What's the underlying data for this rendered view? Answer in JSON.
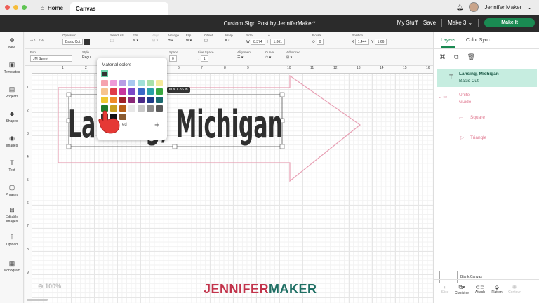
{
  "titlebar": {
    "home_label": "Home",
    "canvas_tab": "Canvas",
    "user_name": "Jennifer Maker",
    "dot_colors": [
      "#ee5f57",
      "#f6bd3a",
      "#5fc453"
    ]
  },
  "header": {
    "doc_title": "Custom Sign Post by JenniferMaker*",
    "my_stuff": "My Stuff",
    "save": "Save",
    "machine": "Make 3",
    "make_it": "Make It"
  },
  "rail": {
    "items": [
      {
        "label": "New",
        "icon": "plus-icon"
      },
      {
        "label": "Templates",
        "icon": "shirt-icon"
      },
      {
        "label": "Projects",
        "icon": "book-icon"
      },
      {
        "label": "Shapes",
        "icon": "shapes-icon"
      },
      {
        "label": "Images",
        "icon": "lightbulb-icon"
      },
      {
        "label": "Text",
        "icon": "text-icon"
      },
      {
        "label": "Phrases",
        "icon": "chat-icon"
      },
      {
        "label": "Editable",
        "label2": "Images",
        "icon": "editable-icon"
      },
      {
        "label": "Upload",
        "icon": "upload-icon"
      },
      {
        "label": "Monogram",
        "icon": "monogram-icon"
      }
    ]
  },
  "toolbar1": {
    "operation_label": "Operation",
    "operation_value": "Basic Cut",
    "select_all": "Select All",
    "edit": "Edit",
    "align": "Align",
    "arrange": "Arrange",
    "flip": "Flip",
    "offset": "Offset",
    "warp": "Warp",
    "size": "Size",
    "w_label": "W",
    "w_value": "8.374",
    "h_label": "H",
    "h_value": "1.861",
    "rotate": "Rotate",
    "rotate_value": "0",
    "position": "Position",
    "x_label": "X",
    "x_value": "1.444",
    "y_label": "Y",
    "y_value": "1.66"
  },
  "toolbar2": {
    "font_label": "Font",
    "font_value": "JM Sweet",
    "style_label": "Style",
    "style_value": "Regul",
    "letter_space": "Space",
    "letter_space_value": "0",
    "line_space": "Line Space",
    "line_space_value": "1",
    "alignment": "Alignment",
    "curve": "Curve",
    "advanced": "Advanced"
  },
  "canvas": {
    "text": "Lansing, Michigan",
    "zoom": "100%",
    "ruler_numbers": [
      "1",
      "2",
      "3",
      "4",
      "5",
      "6",
      "7",
      "8",
      "9",
      "10",
      "11",
      "12",
      "13",
      "14",
      "15",
      "16"
    ],
    "ruler_left": [
      "1",
      "2",
      "3",
      "4",
      "5",
      "6",
      "7",
      "8",
      "9"
    ],
    "size_chip": "in x 1.86 in",
    "arrow_color": "#e8a0b4"
  },
  "popup": {
    "title": "Material colors",
    "more_label": "ed",
    "swatches": [
      "#f5a3ae",
      "#ee9ad8",
      "#b69de5",
      "#a8c8f0",
      "#a0e0d8",
      "#a8e0a8",
      "#f5e99a",
      "#f6c48f",
      "#e03a48",
      "#c8359e",
      "#7a48c8",
      "#3a68c8",
      "#2aa0a8",
      "#3aa840",
      "#eec830",
      "#ef8a28",
      "#a02028",
      "#8a2878",
      "#4a2a88",
      "#1e3a8a",
      "#1a6a70",
      "#1e7a2a",
      "#c8a020",
      "#b86018",
      "#e8e8e8",
      "#c8c8c8",
      "#8a8a8a",
      "#5a5a5a",
      "#333333",
      "#111111",
      "#8a5a30"
    ]
  },
  "panel": {
    "tab_layers": "Layers",
    "tab_color_sync": "Color Sync",
    "layer1_title": "Lansing, Michigan",
    "layer1_sub": "Basic Cut",
    "group_title": "Unite",
    "group_sub": "Guide",
    "child1": "Square",
    "child2": "Triangle",
    "blank_canvas": "Blank Canvas",
    "tools": [
      "Slice",
      "Combine",
      "Attach",
      "Flatten",
      "Contour"
    ]
  },
  "watermark": {
    "part1": "JENNIFER",
    "part2": "MAKER"
  }
}
